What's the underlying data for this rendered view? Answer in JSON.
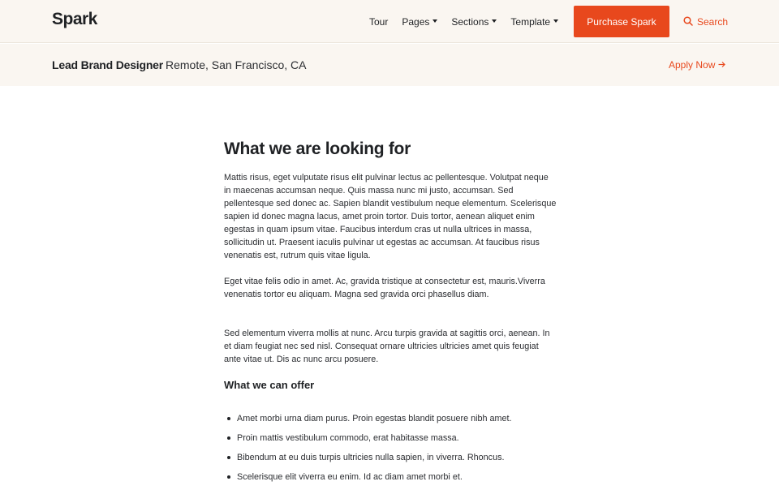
{
  "header": {
    "brand": "Spark",
    "nav": [
      {
        "label": "Tour",
        "has_caret": false
      },
      {
        "label": "Pages",
        "has_caret": true
      },
      {
        "label": "Sections",
        "has_caret": true
      },
      {
        "label": "Template",
        "has_caret": true
      }
    ],
    "purchase_label": "Purchase Spark",
    "search_label": "Search",
    "search_icon": "search-icon"
  },
  "job": {
    "title": "Lead Brand Designer",
    "location": "Remote, San Francisco, CA",
    "apply_label": "Apply Now",
    "apply_icon": "arrow-right-icon"
  },
  "main": {
    "heading": "What we are looking for",
    "paragraphs": [
      "Mattis risus, eget vulputate risus elit pulvinar lectus ac pellentesque. Volutpat neque in maecenas accumsan neque. Quis massa nunc mi justo, accumsan. Sed pellentesque sed donec ac. Sapien blandit vestibulum neque elementum. Scelerisque sapien id donec magna lacus, amet proin tortor. Duis tortor, aenean aliquet enim egestas in quam ipsum vitae. Faucibus interdum cras ut nulla ultrices in massa, sollicitudin ut. Praesent iaculis pulvinar ut egestas ac accumsan. At faucibus risus venenatis est, rutrum quis vitae ligula.",
      "Eget vitae felis odio in amet. Ac, gravida tristique at consectetur est, mauris.Viverra venenatis tortor eu aliquam. Magna sed gravida orci phasellus diam.",
      "Sed elementum viverra mollis at nunc. Arcu turpis gravida at sagittis orci, aenean. In et diam feugiat nec sed nisl. Consequat ornare ultricies ultricies amet quis feugiat ante vitae ut. Dis ac nunc arcu posuere."
    ],
    "offer_heading": "What we can offer",
    "offers": [
      "Amet morbi urna diam purus. Proin egestas blandit posuere nibh amet.",
      "Proin mattis vestibulum commodo, erat habitasse massa.",
      "Bibendum at eu duis turpis ultricies nulla sapien, in viverra. Rhoncus.",
      "Scelerisque elit viverra eu enim. Id ac diam amet morbi et."
    ]
  },
  "colors": {
    "accent": "#e8481d",
    "header_bg": "#faf6f1",
    "text": "#1f2124"
  }
}
